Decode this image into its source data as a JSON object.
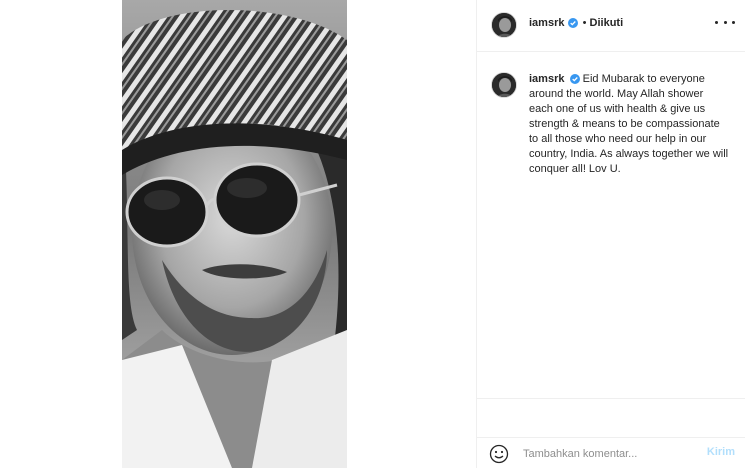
{
  "post": {
    "image_alt": "Black and white portrait photo of a man wearing a patterned bandana and round sunglasses",
    "author": {
      "username": "iamsrk",
      "verified": true
    },
    "header": {
      "separator": "•",
      "follow_status": "Diikuti"
    },
    "caption": {
      "text": "Eid Mubarak to everyone around the world. May Allah shower each one of us with health & give us strength & means to be compassionate to all those who need our help in our country, India. As always together we will conquer all! Lov U."
    },
    "comment_box": {
      "placeholder": "Tambahkan komentar...",
      "submit_label": "Kirim"
    },
    "icons": {
      "verified": "verified-badge-icon",
      "more": "more-options-icon",
      "emoji": "emoji-icon"
    },
    "colors": {
      "verified_blue": "#3897f0",
      "submit_disabled": "#b2dffc",
      "divider": "#efefef"
    }
  }
}
